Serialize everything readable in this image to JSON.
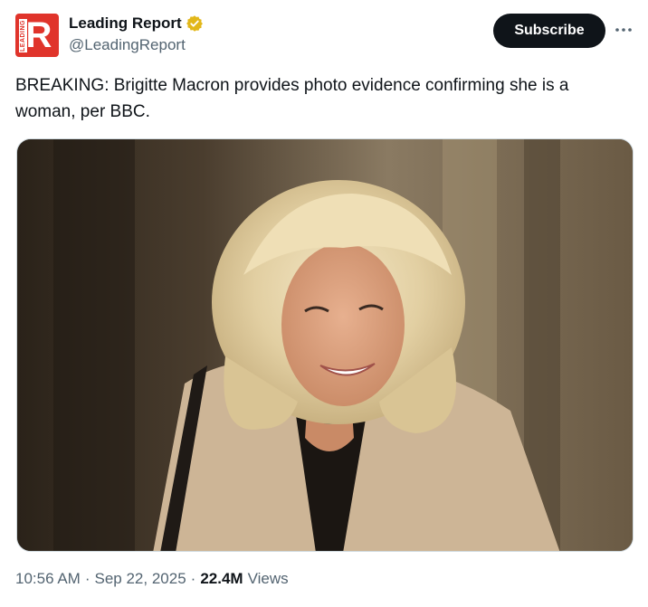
{
  "author": {
    "display_name": "Leading Report",
    "handle": "@LeadingReport",
    "avatar_mark": "R",
    "avatar_vertical_text": "LEADING",
    "avatar_color": "#e0342b",
    "verified_badge": "gold-verified-icon"
  },
  "actions": {
    "subscribe_label": "Subscribe",
    "more_icon": "more-horizontal-icon"
  },
  "tweet": {
    "text": "BREAKING: Brigitte Macron provides photo evidence confirming she is a woman, per BBC."
  },
  "media": {
    "type": "photo"
  },
  "meta": {
    "time": "10:56 AM",
    "separator": "·",
    "date": "Sep 22, 2025",
    "views_count": "22.4M",
    "views_label": "Views"
  },
  "colors": {
    "text_primary": "#0f1419",
    "text_secondary": "#536471",
    "button_bg": "#0f1419",
    "verified_gold": "#e2b719"
  }
}
